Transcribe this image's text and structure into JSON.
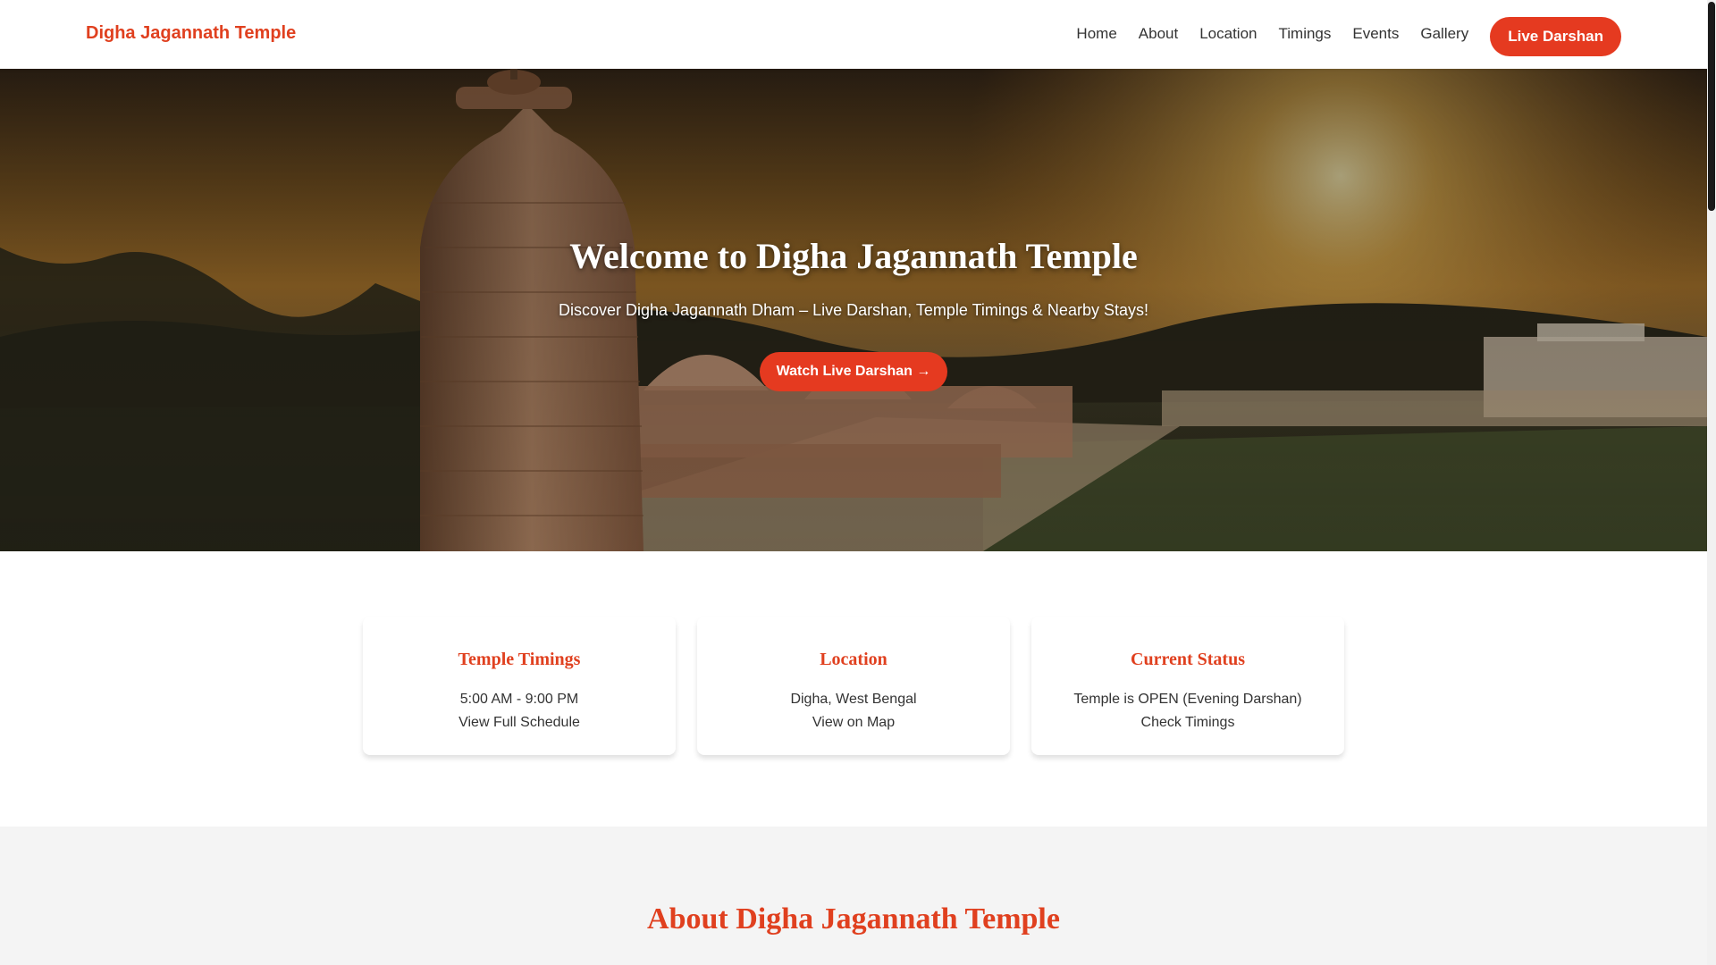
{
  "header": {
    "brand": "Digha Jagannath Temple",
    "nav": [
      {
        "label": "Home"
      },
      {
        "label": "About"
      },
      {
        "label": "Location"
      },
      {
        "label": "Timings"
      },
      {
        "label": "Events"
      },
      {
        "label": "Gallery"
      }
    ],
    "cta_label": "Live Darshan"
  },
  "hero": {
    "title": "Welcome to Digha Jagannath Temple",
    "subtitle": "Discover Digha Jagannath Dham – Live Darshan, Temple Timings & Nearby Stays!",
    "button_label": "Watch Live Darshan →"
  },
  "cards": [
    {
      "title": "Temple Timings",
      "line1": "5:00 AM - 9:00 PM",
      "line2": "View Full Schedule"
    },
    {
      "title": "Location",
      "line1": "Digha, West Bengal",
      "line2": "View on Map"
    },
    {
      "title": "Current Status",
      "line1": "Temple is OPEN (Evening Darshan)",
      "line2": "Check Timings"
    }
  ],
  "about": {
    "title": "About Digha Jagannath Temple"
  },
  "colors": {
    "accent": "#e53a20",
    "heading": "#e0401f",
    "text": "#333333"
  }
}
